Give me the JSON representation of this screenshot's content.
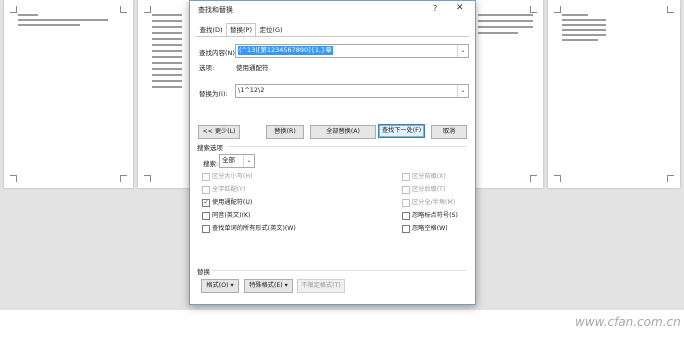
{
  "dialog": {
    "title": "查找和替换",
    "help_glyph": "?",
    "close_glyph": "✕",
    "tabs": [
      {
        "label": "查找(D)"
      },
      {
        "label": "替换(P)"
      },
      {
        "label": "定位(G)"
      }
    ],
    "active_tab": "替换(P)",
    "find": {
      "label": "查找内容(N):",
      "value": "(^13)[第1234567890]{1,}章",
      "options_label": "选项:",
      "options_value": "使用通配符"
    },
    "replace": {
      "label": "替换为(I):",
      "value": "\\1^12\\2"
    },
    "buttons": {
      "less": "<< 更少(L)",
      "replace": "替换(R)",
      "replace_all": "全部替换(A)",
      "find_next": "查找下一处(F)",
      "cancel": "取消"
    },
    "search_options": {
      "title": "搜索选项",
      "search_label": "搜索:",
      "search_value": "全部",
      "left": [
        {
          "label": "区分大小写(H)",
          "checked": false,
          "enabled": false
        },
        {
          "label": "全字匹配(Y)",
          "checked": false,
          "enabled": false
        },
        {
          "label": "使用通配符(U)",
          "checked": true,
          "enabled": true
        },
        {
          "label": "同音(英文)(K)",
          "checked": false,
          "enabled": true
        },
        {
          "label": "查找单词的所有形式(英文)(W)",
          "checked": false,
          "enabled": true
        }
      ],
      "right": [
        {
          "label": "区分前缀(X)",
          "checked": false,
          "enabled": false
        },
        {
          "label": "区分后缀(T)",
          "checked": false,
          "enabled": false
        },
        {
          "label": "区分全/半角(M)",
          "checked": false,
          "enabled": false
        },
        {
          "label": "忽略标点符号(S)",
          "checked": false,
          "enabled": true
        },
        {
          "label": "忽略空格(W)",
          "checked": false,
          "enabled": true
        }
      ]
    },
    "replace_section": {
      "title": "替换",
      "format": "格式(O) ▾",
      "special": "特殊格式(E) ▾",
      "no_format": "不限定格式(T)"
    },
    "check_glyph": "✓",
    "arrow_glyph": "⌄"
  },
  "watermark": "www.cfan.com.cn",
  "colors": {
    "accent": "#3399ff",
    "dialog_border": "#7a9cc6",
    "page_bg": "#e3e3e3"
  }
}
